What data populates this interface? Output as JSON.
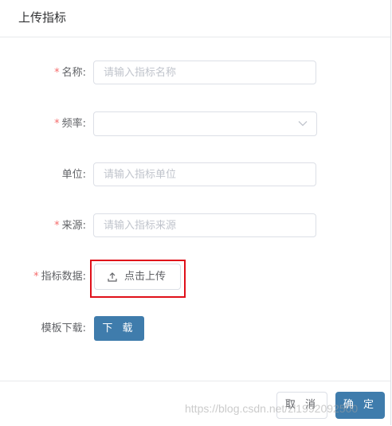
{
  "dialog": {
    "title": "上传指标"
  },
  "form": {
    "name": {
      "label": "名称:",
      "required_mark": "*",
      "placeholder": "请输入指标名称",
      "value": ""
    },
    "frequency": {
      "label": "频率:",
      "required_mark": "*",
      "selected": "",
      "icon": "chevron-down-icon"
    },
    "unit": {
      "label": "单位:",
      "placeholder": "请输入指标单位",
      "value": ""
    },
    "source": {
      "label": "来源:",
      "required_mark": "*",
      "placeholder": "请输入指标来源",
      "value": ""
    },
    "data": {
      "label": "指标数据:",
      "required_mark": "*",
      "upload_label": "点击上传",
      "icon": "upload-icon"
    },
    "template": {
      "label": "模板下载:",
      "download_label": "下 载"
    }
  },
  "footer": {
    "cancel_label": "取 消",
    "confirm_label": "确 定"
  },
  "watermark": "https://blog.csdn.net/zl1992092500",
  "colors": {
    "primary": "#3f7cac",
    "required": "#f56c6c",
    "highlight": "#e0101a",
    "border": "#dcdfe6"
  }
}
